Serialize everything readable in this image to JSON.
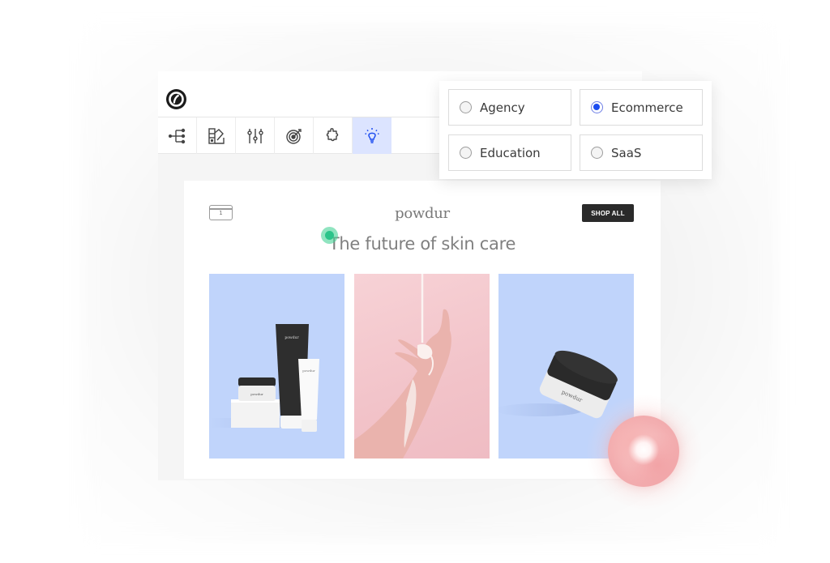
{
  "editor": {
    "logo_icon": "unbounce-logo",
    "toolbar": [
      {
        "name": "page-structure",
        "icon": "tree-icon",
        "active": false
      },
      {
        "name": "style-guide",
        "icon": "swatch-icon",
        "active": false
      },
      {
        "name": "settings-sliders",
        "icon": "sliders-icon",
        "active": false
      },
      {
        "name": "goals",
        "icon": "target-icon",
        "active": false
      },
      {
        "name": "integrations",
        "icon": "puzzle-icon",
        "active": false
      },
      {
        "name": "smart-builder",
        "icon": "lightbulb-icon",
        "active": true
      }
    ]
  },
  "industry_picker": {
    "options": [
      {
        "label": "Agency",
        "selected": false
      },
      {
        "label": "Ecommerce",
        "selected": true
      },
      {
        "label": "Education",
        "selected": false
      },
      {
        "label": "SaaS",
        "selected": false
      }
    ]
  },
  "preview": {
    "cart_count": "1",
    "brand": "powdur",
    "shop_button": "SHOP ALL",
    "headline": "The future of skin care",
    "tiles": [
      {
        "alt": "powdur product set: jar, black tube, white tube"
      },
      {
        "alt": "hand with cream on pink background"
      },
      {
        "alt": "tilted powdur jar with black lid"
      }
    ],
    "product_label": "powdur"
  },
  "colors": {
    "accent_blue": "#1c4cf0",
    "active_tool_bg": "#dce4ff",
    "tile_blue": "#c0d4fb",
    "tile_pink": "#f2c3c9",
    "cursor_green": "#2bc48a",
    "button_dark": "#2a2a2a"
  }
}
